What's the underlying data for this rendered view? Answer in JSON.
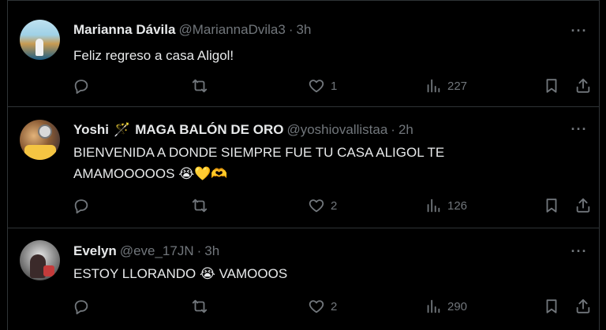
{
  "tweets": [
    {
      "name": "Marianna Dávila",
      "handle": "@MariannaDvila3",
      "sep": "·",
      "time": "3h",
      "text": "Feliz regreso a casa Aligol!",
      "emoji": "",
      "text_line2": "",
      "likes": "1",
      "views": "227",
      "avatar": "stadium-photo"
    },
    {
      "name_part1": "Yoshi",
      "wand": "🪄",
      "name_part2": "MAGA BALÓN DE ORO",
      "handle": "@yoshiovallistaa",
      "sep": "·",
      "time": "2h",
      "text": "BIENVENIDA A DONDE SIEMPRE FUE TU CASA ALIGOL TE",
      "text_line2": "AMAMOOOOOS",
      "emoji": "😭💛🫶",
      "likes": "2",
      "views": "126",
      "avatar": "trophy-photo"
    },
    {
      "name": "Evelyn",
      "handle": "@eve_17JN",
      "sep": "·",
      "time": "3h",
      "text": "ESTOY LLORANDO",
      "emoji": "😭",
      "text_after": "VAMOOOS",
      "likes": "2",
      "views": "290",
      "avatar": "person-photo"
    }
  ],
  "icons": {
    "more": "more-dots-icon",
    "reply": "reply-icon",
    "retweet": "retweet-icon",
    "like": "heart-icon",
    "views": "views-icon",
    "bookmark": "bookmark-icon",
    "share": "share-icon"
  },
  "colors": {
    "background": "#000000",
    "text": "#e7e9ea",
    "muted": "#71767b",
    "divider": "#2f3336"
  }
}
